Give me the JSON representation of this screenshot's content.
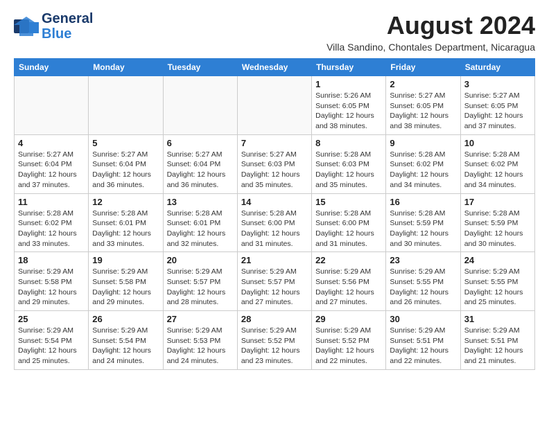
{
  "header": {
    "logo_line1": "General",
    "logo_line2": "Blue",
    "month_year": "August 2024",
    "location": "Villa Sandino, Chontales Department, Nicaragua"
  },
  "days_of_week": [
    "Sunday",
    "Monday",
    "Tuesday",
    "Wednesday",
    "Thursday",
    "Friday",
    "Saturday"
  ],
  "weeks": [
    [
      {
        "day": "",
        "info": ""
      },
      {
        "day": "",
        "info": ""
      },
      {
        "day": "",
        "info": ""
      },
      {
        "day": "",
        "info": ""
      },
      {
        "day": "1",
        "info": "Sunrise: 5:26 AM\nSunset: 6:05 PM\nDaylight: 12 hours\nand 38 minutes."
      },
      {
        "day": "2",
        "info": "Sunrise: 5:27 AM\nSunset: 6:05 PM\nDaylight: 12 hours\nand 38 minutes."
      },
      {
        "day": "3",
        "info": "Sunrise: 5:27 AM\nSunset: 6:05 PM\nDaylight: 12 hours\nand 37 minutes."
      }
    ],
    [
      {
        "day": "4",
        "info": "Sunrise: 5:27 AM\nSunset: 6:04 PM\nDaylight: 12 hours\nand 37 minutes."
      },
      {
        "day": "5",
        "info": "Sunrise: 5:27 AM\nSunset: 6:04 PM\nDaylight: 12 hours\nand 36 minutes."
      },
      {
        "day": "6",
        "info": "Sunrise: 5:27 AM\nSunset: 6:04 PM\nDaylight: 12 hours\nand 36 minutes."
      },
      {
        "day": "7",
        "info": "Sunrise: 5:27 AM\nSunset: 6:03 PM\nDaylight: 12 hours\nand 35 minutes."
      },
      {
        "day": "8",
        "info": "Sunrise: 5:28 AM\nSunset: 6:03 PM\nDaylight: 12 hours\nand 35 minutes."
      },
      {
        "day": "9",
        "info": "Sunrise: 5:28 AM\nSunset: 6:02 PM\nDaylight: 12 hours\nand 34 minutes."
      },
      {
        "day": "10",
        "info": "Sunrise: 5:28 AM\nSunset: 6:02 PM\nDaylight: 12 hours\nand 34 minutes."
      }
    ],
    [
      {
        "day": "11",
        "info": "Sunrise: 5:28 AM\nSunset: 6:02 PM\nDaylight: 12 hours\nand 33 minutes."
      },
      {
        "day": "12",
        "info": "Sunrise: 5:28 AM\nSunset: 6:01 PM\nDaylight: 12 hours\nand 33 minutes."
      },
      {
        "day": "13",
        "info": "Sunrise: 5:28 AM\nSunset: 6:01 PM\nDaylight: 12 hours\nand 32 minutes."
      },
      {
        "day": "14",
        "info": "Sunrise: 5:28 AM\nSunset: 6:00 PM\nDaylight: 12 hours\nand 31 minutes."
      },
      {
        "day": "15",
        "info": "Sunrise: 5:28 AM\nSunset: 6:00 PM\nDaylight: 12 hours\nand 31 minutes."
      },
      {
        "day": "16",
        "info": "Sunrise: 5:28 AM\nSunset: 5:59 PM\nDaylight: 12 hours\nand 30 minutes."
      },
      {
        "day": "17",
        "info": "Sunrise: 5:28 AM\nSunset: 5:59 PM\nDaylight: 12 hours\nand 30 minutes."
      }
    ],
    [
      {
        "day": "18",
        "info": "Sunrise: 5:29 AM\nSunset: 5:58 PM\nDaylight: 12 hours\nand 29 minutes."
      },
      {
        "day": "19",
        "info": "Sunrise: 5:29 AM\nSunset: 5:58 PM\nDaylight: 12 hours\nand 29 minutes."
      },
      {
        "day": "20",
        "info": "Sunrise: 5:29 AM\nSunset: 5:57 PM\nDaylight: 12 hours\nand 28 minutes."
      },
      {
        "day": "21",
        "info": "Sunrise: 5:29 AM\nSunset: 5:57 PM\nDaylight: 12 hours\nand 27 minutes."
      },
      {
        "day": "22",
        "info": "Sunrise: 5:29 AM\nSunset: 5:56 PM\nDaylight: 12 hours\nand 27 minutes."
      },
      {
        "day": "23",
        "info": "Sunrise: 5:29 AM\nSunset: 5:55 PM\nDaylight: 12 hours\nand 26 minutes."
      },
      {
        "day": "24",
        "info": "Sunrise: 5:29 AM\nSunset: 5:55 PM\nDaylight: 12 hours\nand 25 minutes."
      }
    ],
    [
      {
        "day": "25",
        "info": "Sunrise: 5:29 AM\nSunset: 5:54 PM\nDaylight: 12 hours\nand 25 minutes."
      },
      {
        "day": "26",
        "info": "Sunrise: 5:29 AM\nSunset: 5:54 PM\nDaylight: 12 hours\nand 24 minutes."
      },
      {
        "day": "27",
        "info": "Sunrise: 5:29 AM\nSunset: 5:53 PM\nDaylight: 12 hours\nand 24 minutes."
      },
      {
        "day": "28",
        "info": "Sunrise: 5:29 AM\nSunset: 5:52 PM\nDaylight: 12 hours\nand 23 minutes."
      },
      {
        "day": "29",
        "info": "Sunrise: 5:29 AM\nSunset: 5:52 PM\nDaylight: 12 hours\nand 22 minutes."
      },
      {
        "day": "30",
        "info": "Sunrise: 5:29 AM\nSunset: 5:51 PM\nDaylight: 12 hours\nand 22 minutes."
      },
      {
        "day": "31",
        "info": "Sunrise: 5:29 AM\nSunset: 5:51 PM\nDaylight: 12 hours\nand 21 minutes."
      }
    ]
  ]
}
